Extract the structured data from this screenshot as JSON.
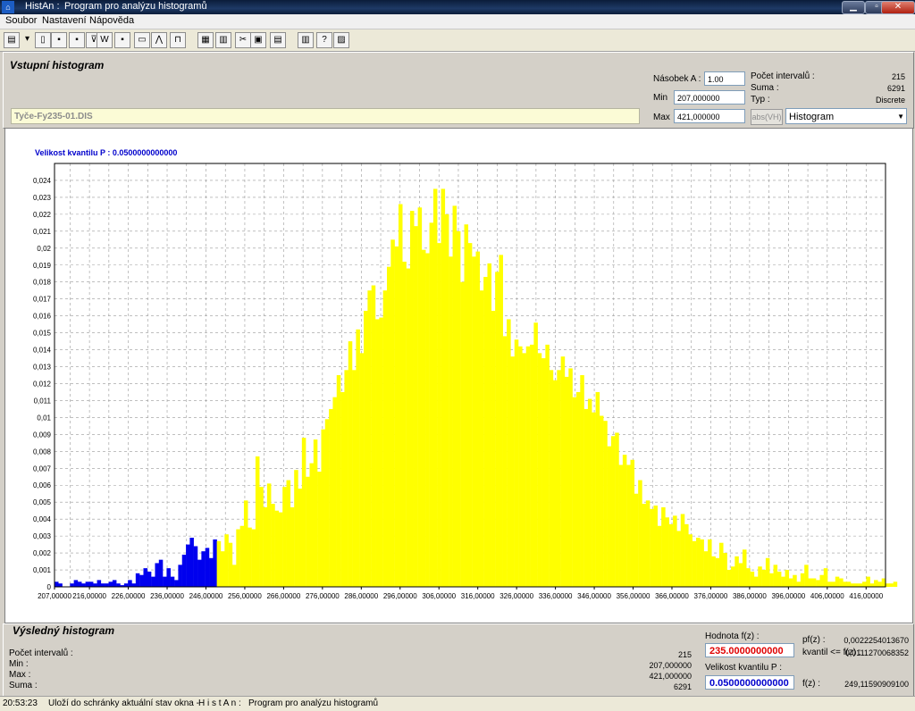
{
  "window": {
    "app_name": "HistAn :",
    "title": "Program pro analýzu histogramů",
    "minimize": "▁",
    "maximize": "▫",
    "close": "✕"
  },
  "menu": [
    "Soubor",
    "Nastavení",
    "Nápověda"
  ],
  "toolbar_icons": [
    "open-folder-icon",
    "dropdown-arrow-icon",
    "new-document-icon",
    "save-icon",
    "save-as-icon",
    "filter-icon",
    "word-icon",
    "floppy-icon",
    "window-icon",
    "graph-icon",
    "step-icon",
    "palette-icon",
    "columns-icon",
    "cut-icon",
    "copy-icon",
    "paste-icon",
    "book-icon",
    "help-icon",
    "info-icon"
  ],
  "input_section": {
    "heading": "Vstupní histogram",
    "nasobek_label": "Násobek A :",
    "nasobek_value": "1.00",
    "min_label": "Min",
    "min_value": "207,000000",
    "max_label": "Max",
    "max_value": "421,000000",
    "abs_button": "abs(VH)",
    "pocet_label": "Počet intervalů :",
    "pocet_value": "215",
    "suma_label": "Suma :",
    "suma_value": "6291",
    "typ_label": "Typ :",
    "typ_value": "Discrete",
    "type_select": "Histogram",
    "file_name": "Tyče-Fy235-01.DIS"
  },
  "chart_data": {
    "type": "bar",
    "title": "Velikost kvantilu P : 0.0500000000000",
    "xlabel": "",
    "ylabel": "",
    "xlim": [
      207,
      421
    ],
    "ylim": [
      0,
      0.025
    ],
    "x_ticks": [
      "207,00000",
      "216,00000",
      "226,00000",
      "236,00000",
      "246,00000",
      "256,00000",
      "266,00000",
      "276,00000",
      "286,00000",
      "296,00000",
      "306,00000",
      "316,00000",
      "326,00000",
      "336,00000",
      "346,00000",
      "356,00000",
      "366,00000",
      "376,00000",
      "386,00000",
      "396,00000",
      "406,00000",
      "416,00000"
    ],
    "y_ticks": [
      "0",
      "0,001",
      "0,002",
      "0,003",
      "0,004",
      "0,005",
      "0,006",
      "0,007",
      "0,008",
      "0,009",
      "0,01",
      "0,011",
      "0,012",
      "0,013",
      "0,014",
      "0,015",
      "0,016",
      "0,017",
      "0,018",
      "0,019",
      "0,02",
      "0,021",
      "0,022",
      "0,023",
      "0,024"
    ],
    "grid": true,
    "quantile_boundary": 235,
    "colors": {
      "below_quantile": "#0000ee",
      "above_quantile": "#ffff00",
      "title": "#0000cc"
    },
    "x_start": 207,
    "values": [
      0.0003,
      0.0002,
      0,
      0,
      0.0002,
      0.0004,
      0.0003,
      0.0002,
      0.0003,
      0.0003,
      0.0002,
      0.0004,
      0.0002,
      0.0002,
      0.0003,
      0.0004,
      0.0002,
      0.0001,
      0.0002,
      0.0004,
      0.0002,
      0.0008,
      0.0007,
      0.0011,
      0.0009,
      0.0006,
      0.0014,
      0.0016,
      0.0006,
      0.0011,
      0.0006,
      0.0004,
      0.0013,
      0.0019,
      0.0025,
      0.0029,
      0.0024,
      0.0016,
      0.0021,
      0.0023,
      0.0017,
      0.0028,
      0.0027,
      0.0021,
      0.0031,
      0.0026,
      0.0013,
      0.0034,
      0.0036,
      0.0051,
      0.0035,
      0.0034,
      0.0077,
      0.0059,
      0.0047,
      0.0061,
      0.0049,
      0.0045,
      0.0044,
      0.0059,
      0.0063,
      0.0047,
      0.0069,
      0.0058,
      0.0088,
      0.0065,
      0.0073,
      0.0087,
      0.0068,
      0.0093,
      0.0099,
      0.0105,
      0.0112,
      0.0125,
      0.0115,
      0.0128,
      0.0145,
      0.0128,
      0.0152,
      0.0138,
      0.0163,
      0.0175,
      0.0178,
      0.0158,
      0.0159,
      0.0175,
      0.0189,
      0.0205,
      0.0201,
      0.0226,
      0.0192,
      0.0188,
      0.0222,
      0.0213,
      0.0224,
      0.0199,
      0.0197,
      0.0215,
      0.0235,
      0.0203,
      0.0235,
      0.022,
      0.0195,
      0.0225,
      0.021,
      0.018,
      0.0214,
      0.0203,
      0.0195,
      0.0198,
      0.0175,
      0.0183,
      0.0191,
      0.0163,
      0.0186,
      0.0196,
      0.0148,
      0.0158,
      0.0136,
      0.0146,
      0.0142,
      0.0138,
      0.0142,
      0.0143,
      0.0156,
      0.0138,
      0.0135,
      0.0143,
      0.0128,
      0.0122,
      0.0128,
      0.0136,
      0.0124,
      0.0129,
      0.0112,
      0.0115,
      0.0125,
      0.0105,
      0.0111,
      0.0103,
      0.0115,
      0.0101,
      0.0098,
      0.0083,
      0.0089,
      0.0091,
      0.0072,
      0.0078,
      0.0072,
      0.0075,
      0.0055,
      0.0063,
      0.0049,
      0.0051,
      0.0046,
      0.0048,
      0.0036,
      0.0047,
      0.0041,
      0.0037,
      0.0042,
      0.0033,
      0.0043,
      0.0037,
      0.0031,
      0.0027,
      0.0029,
      0.0028,
      0.0021,
      0.0028,
      0.0018,
      0.0017,
      0.0026,
      0.002,
      0.001,
      0.0012,
      0.0018,
      0.0014,
      0.0022,
      0.0011,
      0.0009,
      0.0006,
      0.0012,
      0.001,
      0.0017,
      0.0008,
      0.0013,
      0.0009,
      0.0006,
      0.001,
      0.0005,
      0.0007,
      0.0003,
      0.0008,
      0.0013,
      0.0005,
      0.0005,
      0.0004,
      0.0007,
      0.0011,
      0.0003,
      0.0003,
      0.0006,
      0.0005,
      0.0003,
      0.0003,
      0.0002,
      0.0002,
      0.0002,
      0.0003,
      0.0006,
      0.0002,
      0.0004,
      0.0003,
      0.0005,
      0.0002,
      0.0002,
      0.0003
    ]
  },
  "result_section": {
    "heading": "Výsledný histogram",
    "pocet_label": "Počet intervalů :",
    "pocet_value": "215",
    "min_label": "Min :",
    "min_value": "207,000000",
    "max_label": "Max :",
    "max_value": "421,000000",
    "suma_label": "Suma :",
    "suma_value": "6291",
    "hodnota_label": "Hodnota f(z) :",
    "hodnota_value": "235.0000000000",
    "kvantil_label": "Velikost kvantilu P :",
    "kvantil_value": "0.0500000000000",
    "pfz_label": "pf(z) :",
    "pfz_value": "0,0022254013670",
    "kvantil_le_label": "kvantil <= f(z) :",
    "kvantil_le_value": "0,0111270068352",
    "fz_label": "f(z) :",
    "fz_value": "249,11590909100"
  },
  "status": {
    "time": "20:53:23",
    "hint": "Uloží do schránky aktuální stav okna -",
    "app": "H i s t A n :",
    "desc": "Program pro analýzu histogramů"
  }
}
